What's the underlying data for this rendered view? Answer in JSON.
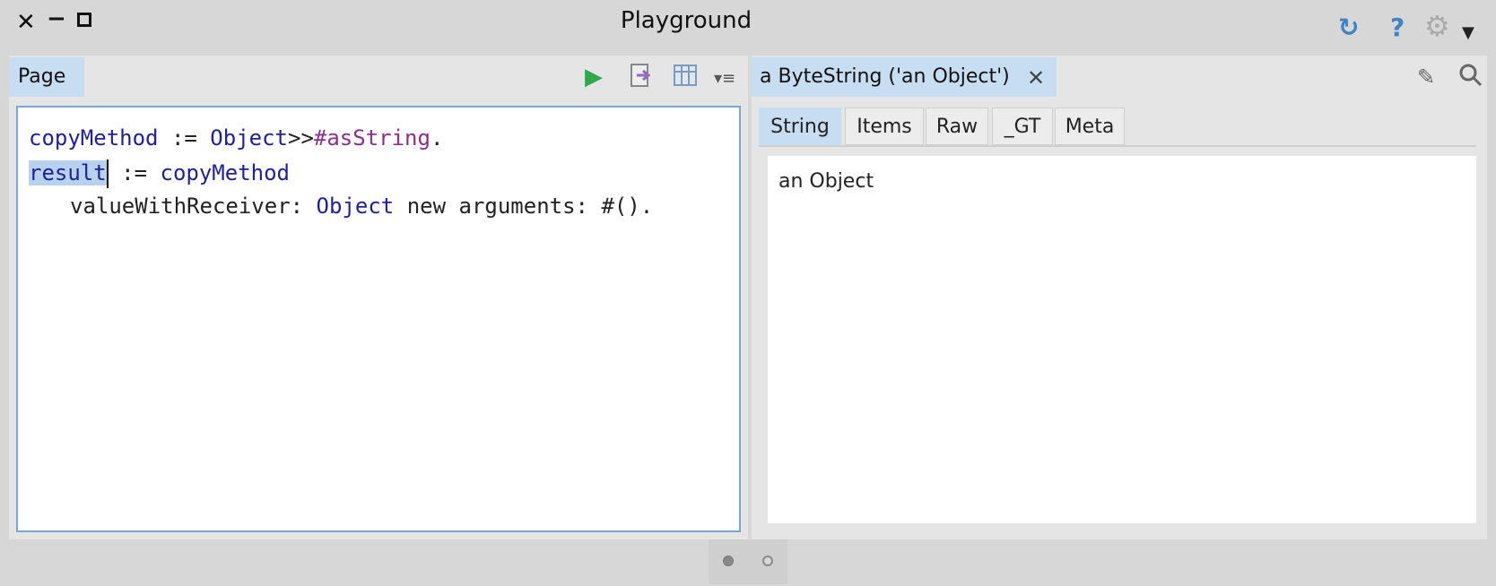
{
  "window": {
    "title": "Playground",
    "close_glyph": "✕",
    "minimize_glyph": "−"
  },
  "playground": {
    "page_tab": "Page",
    "code": {
      "line1": {
        "a": "copyMethod",
        "b": " := ",
        "c": "Object",
        "d": ">>",
        "e": "#asString",
        "f": "."
      },
      "line2": {
        "selected": "result",
        "b": " := ",
        "c": "copyMethod"
      },
      "line3": {
        "a": "valueWithReceiver: ",
        "b": "Object",
        "c": " new arguments: #()."
      }
    }
  },
  "inspector": {
    "tab_title": "a ByteString ('an Object')",
    "tabs": [
      "String",
      "Items",
      "Raw",
      "_GT",
      "Meta"
    ],
    "active_tab": "String",
    "string_value": "an Object"
  },
  "icons": {
    "sync": "sync-icon",
    "help": "help-icon",
    "settings": "gear-icon",
    "menu": "chevron-down-icon",
    "run": "play-icon",
    "inspect": "inspect-icon",
    "bindings": "table-icon",
    "options": "lines-icon",
    "close_tab": "close-icon",
    "edit": "edit-icon",
    "search": "search-icon"
  },
  "colors": {
    "accent_tab": "#c7ddf2",
    "run_green": "#2fa84f",
    "keyword_blue": "#1f1fa0",
    "symbol_purple": "#8e2f8e"
  }
}
